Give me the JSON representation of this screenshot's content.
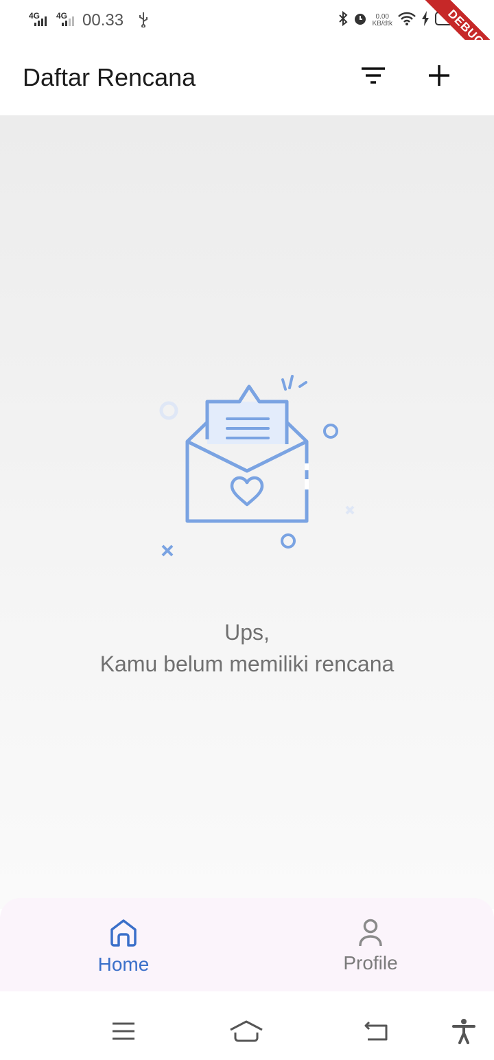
{
  "status_bar": {
    "network_1": "4G",
    "network_2": "4G",
    "time": "00.33",
    "net_speed_value": "0.00",
    "net_speed_unit": "KB/dtk",
    "debug_label": "DEBUG"
  },
  "app_bar": {
    "title": "Daftar Rencana",
    "filter_icon": "filter-icon",
    "add_icon": "plus-icon"
  },
  "empty_state": {
    "illustration": "open-envelope-heart",
    "line1": "Ups,",
    "line2": "Kamu belum memiliki rencana"
  },
  "bottom_nav": {
    "items": [
      {
        "label": "Home",
        "icon": "home-icon",
        "active": true
      },
      {
        "label": "Profile",
        "icon": "person-icon",
        "active": false
      }
    ],
    "active_color": "#3a6fc9",
    "inactive_color": "#7a7a7a"
  },
  "system_nav": {
    "buttons": [
      "menu-icon",
      "home-icon",
      "back-icon",
      "accessibility-icon"
    ]
  }
}
